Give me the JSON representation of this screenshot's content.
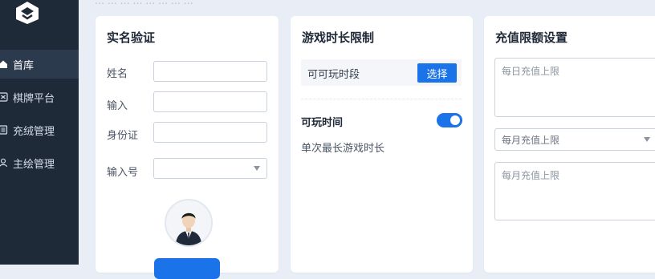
{
  "header": {
    "breadcrumb": "… … … … … … … …"
  },
  "sidebar": {
    "logo": "app-logo",
    "items": [
      {
        "label": "首库",
        "icon": "home-icon",
        "active": true
      },
      {
        "label": "棋牌平台",
        "icon": "chess-icon",
        "active": false
      },
      {
        "label": "充绒管理",
        "icon": "doc-icon",
        "active": false
      },
      {
        "label": "主绘管理",
        "icon": "user-icon",
        "active": false
      }
    ]
  },
  "realname": {
    "title": "实名验证",
    "fields": [
      {
        "label": "姓名",
        "value": ""
      },
      {
        "label": "输入",
        "value": ""
      },
      {
        "label": "身份证",
        "value": ""
      },
      {
        "label": "输入号",
        "value": ""
      }
    ],
    "avatar_icon": "person-avatar-icon"
  },
  "gametime": {
    "title": "游戏时长限制",
    "period_label": "可可玩时段",
    "select_button": "选择",
    "play_time_label": "可玩时间",
    "toggle_on": true,
    "single_max_label": "单次最长游戏时长"
  },
  "recharge": {
    "title": "充值限额设置",
    "daily_placeholder": "每日充值上限",
    "monthly_select": "每月充值上限",
    "monthly_textarea_placeholder": "每月充值上限"
  },
  "colors": {
    "accent": "#1a73e8",
    "sidebar": "#1e2a38",
    "sidebar_active": "#2c3a4d",
    "page_bg": "#e9eef6"
  }
}
